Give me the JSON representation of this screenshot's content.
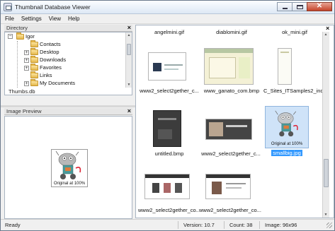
{
  "window": {
    "title": "Thumbnail Database Viewer"
  },
  "menu": [
    "File",
    "Settings",
    "View",
    "Help"
  ],
  "directory": {
    "pane_title": "Directory",
    "items": [
      {
        "label": "Igor"
      },
      {
        "label": "Contacts"
      },
      {
        "label": "Desktop"
      },
      {
        "label": "Downloads"
      },
      {
        "label": "Favorites"
      },
      {
        "label": "Links"
      },
      {
        "label": "My Documents"
      }
    ],
    "selected_file": "Thumbs.db"
  },
  "preview": {
    "pane_title": "Image Preview",
    "caption": "Original at 100%"
  },
  "thumbnails": [
    {
      "label": "angelmini.gif"
    },
    {
      "label": "diablomini.gif"
    },
    {
      "label": "ok_mini.gif"
    },
    {
      "label": "www2_select2gether_c..."
    },
    {
      "label": "www_ganato_com.bmp"
    },
    {
      "label": "C_Sites_ITSamples2_ind..."
    },
    {
      "label": "untitled.bmp"
    },
    {
      "label": "www2_select2gether_c..."
    },
    {
      "label": "smallbig.jpg",
      "selected": true,
      "caption": "Original at 100%"
    },
    {
      "label": "www2_select2gether_co..."
    },
    {
      "label": "www2_select2gether_co..."
    }
  ],
  "status": {
    "state": "Ready",
    "version": "Version: 10.7",
    "count": "Count: 38",
    "image": "Image: 96x96"
  },
  "colors": {
    "selection": "#3399ff",
    "selection_bg": "#cfe3f8",
    "close_button": "#c4442a"
  }
}
